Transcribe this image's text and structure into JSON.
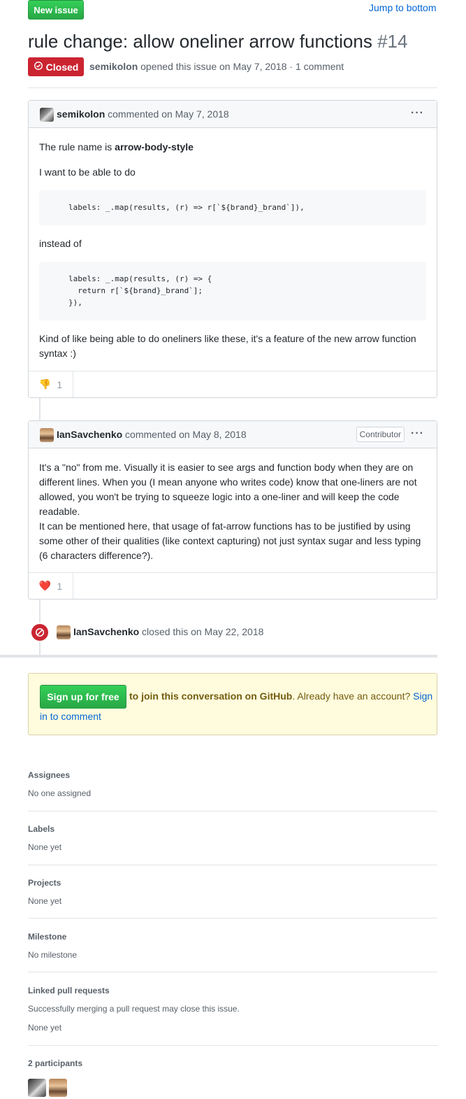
{
  "header": {
    "new_issue_label": "New issue",
    "jump_label": "Jump to bottom"
  },
  "issue": {
    "title": "rule change: allow oneliner arrow functions",
    "number": "#14",
    "state": "Closed",
    "author": "semikolon",
    "opened_text": "opened this issue on May 7, 2018 · 1 comment"
  },
  "comments": [
    {
      "author": "semikolon",
      "action": "commented",
      "date": "on May 7, 2018",
      "line1_prefix": "The rule name is ",
      "line1_bold": "arrow-body-style",
      "line2": "I want to be able to do",
      "code1": "labels: _.map(results, (r) => r[`${brand}_brand`]),",
      "line3": "instead of",
      "code2": "labels: _.map(results, (r) => {\n  return r[`${brand}_brand`];\n}),",
      "line4a": "Kind of like being able to do oneliners like these, it's a feature of the new arrow function",
      "line4b": "syntax :)",
      "reaction_emoji": "👎",
      "reaction_count": "1"
    },
    {
      "author": "IanSavchenko",
      "action": "commented",
      "date": "on May 8, 2018",
      "badge": "Contributor",
      "lines": [
        "It's a \"no\" from me. Visually it is easier to see args and function body when they are on",
        "different lines. When you (I mean anyone who writes code) know that one-liners are not",
        "allowed, you won't be trying to squeeze logic into a one-liner and will keep the code",
        "readable.",
        "It can be mentioned here, that usage of fat-arrow functions has to be justified by using",
        "some other of their qualities (like context capturing) not just syntax sugar and less typing",
        "(6 characters difference?)."
      ],
      "reaction_emoji": "❤️",
      "reaction_count": "1"
    }
  ],
  "event": {
    "actor": "IanSavchenko",
    "action": "closed this",
    "date": "on May 22, 2018"
  },
  "signup": {
    "button": "Sign up for free",
    "bold_text": "to join this conversation on GitHub",
    "rest": ". Already have an account? ",
    "link1": "Sign",
    "link2": "in to comment"
  },
  "sidebar": {
    "assignees_h": "Assignees",
    "assignees_v": "No one assigned",
    "labels_h": "Labels",
    "labels_v": "None yet",
    "projects_h": "Projects",
    "projects_v": "None yet",
    "milestone_h": "Milestone",
    "milestone_v": "No milestone",
    "linked_h": "Linked pull requests",
    "linked_note": "Successfully merging a pull request may close this issue.",
    "linked_v": "None yet",
    "participants_h": "2 participants"
  },
  "colors": {
    "green": "#28a745",
    "closed_red": "#cb2431",
    "link": "#0366d6"
  }
}
